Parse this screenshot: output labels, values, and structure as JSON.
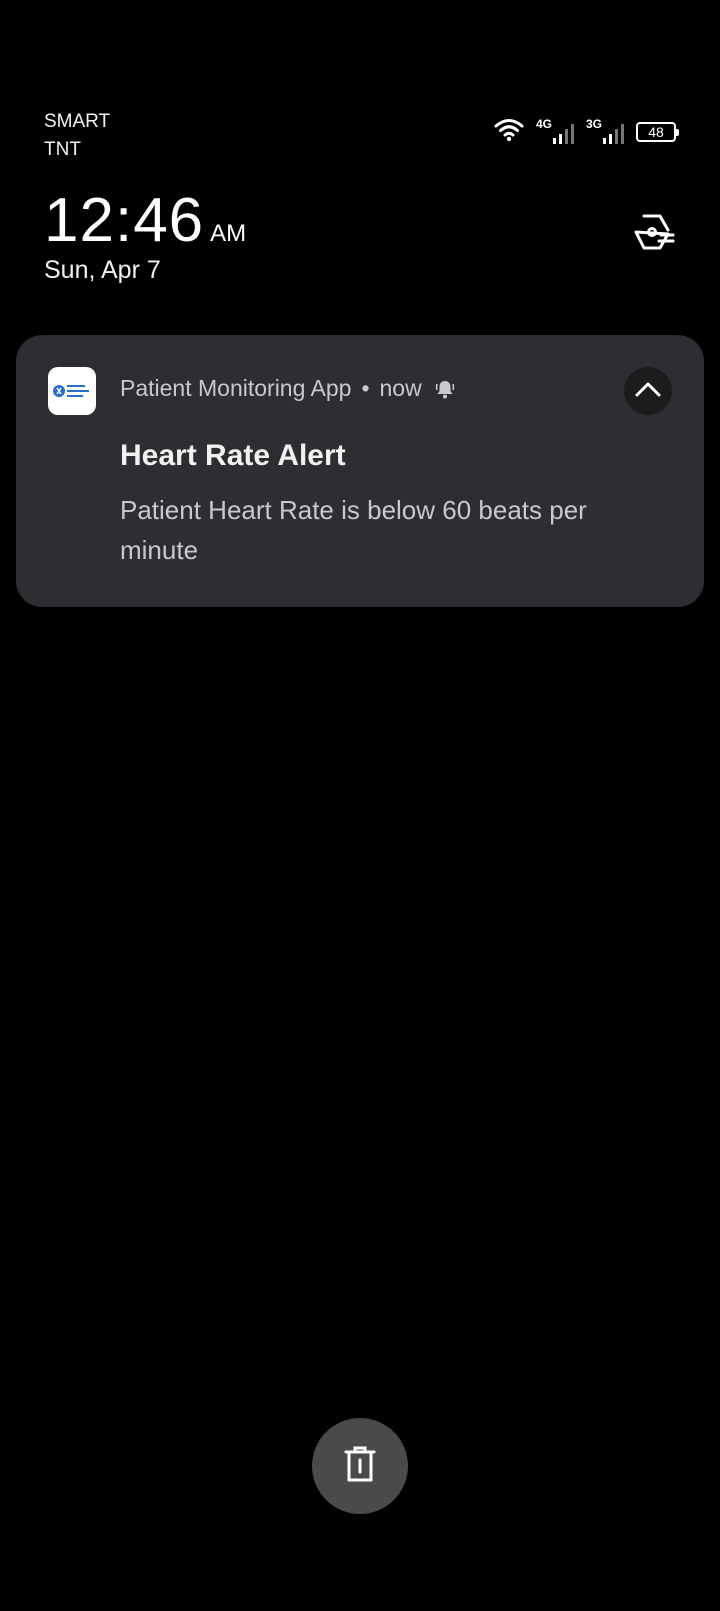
{
  "status_bar": {
    "carrier_1": "SMART",
    "carrier_2": "TNT",
    "network_1": "4G",
    "network_2": "3G",
    "battery_level": "48",
    "icons": [
      "wifi-icon",
      "signal-icon",
      "signal-icon",
      "battery-icon"
    ]
  },
  "lockscreen": {
    "time": "12:46",
    "ampm": "AM",
    "date": "Sun, Apr 7",
    "settings_icon": "settings-icon"
  },
  "notification": {
    "app_name": "Patient Monitoring App",
    "separator": "•",
    "timestamp": "now",
    "alert_icon": "bell-icon",
    "collapse_icon": "chevron-up-icon",
    "title": "Heart Rate Alert",
    "body": "Patient Heart Rate is below 60 beats per minute"
  },
  "actions": {
    "clear_icon": "trash-icon"
  },
  "colors": {
    "background": "#000000",
    "card": "#2d2e31",
    "text_primary": "#f1f1f1",
    "text_secondary": "#c8c9cc",
    "clear_button": "#4a4a4c",
    "app_icon_accent": "#2a6fc9"
  }
}
